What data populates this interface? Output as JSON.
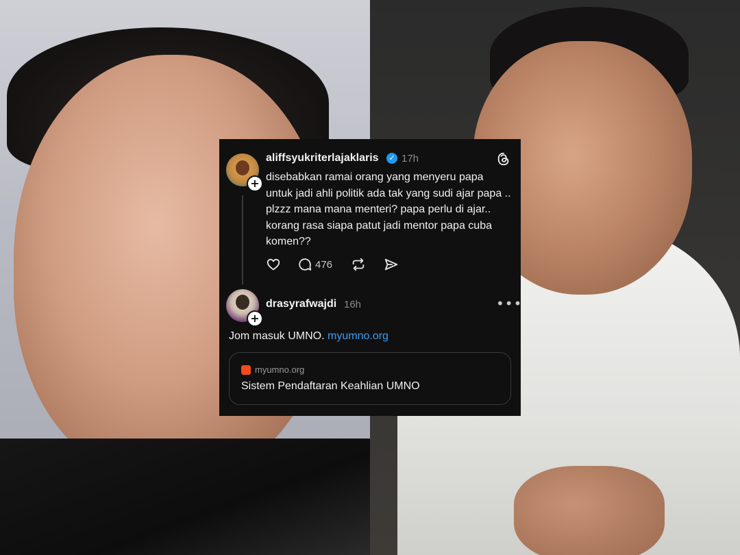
{
  "post": {
    "username": "aliffsyukriterlajaklaris",
    "time": "17h",
    "text": "disebabkan ramai orang yang menyeru papa untuk jadi ahli politik ada tak yang sudi ajar papa .. plzzz mana mana menteri? papa perlu di ajar.. korang rasa siapa patut jadi mentor papa cuba komen??",
    "reply_count": "476",
    "icons": [
      "heart-icon",
      "comment-icon",
      "repost-icon",
      "share-icon",
      "threads-logo-icon",
      "verified-badge-icon"
    ]
  },
  "reply": {
    "username": "drasyrafwajdi",
    "time": "16h",
    "text": "Jom masuk UMNO.",
    "link_text": "myumno.org",
    "more_icon": "more-dots-icon"
  },
  "link_preview": {
    "domain": "myumno.org",
    "title": "Sistem Pendaftaran Keahlian UMNO",
    "favicon_color": "#f24a1d"
  },
  "colors": {
    "card_bg": "#101010",
    "link_blue": "#3b9cf3",
    "verified_blue": "#1d9bf0"
  }
}
